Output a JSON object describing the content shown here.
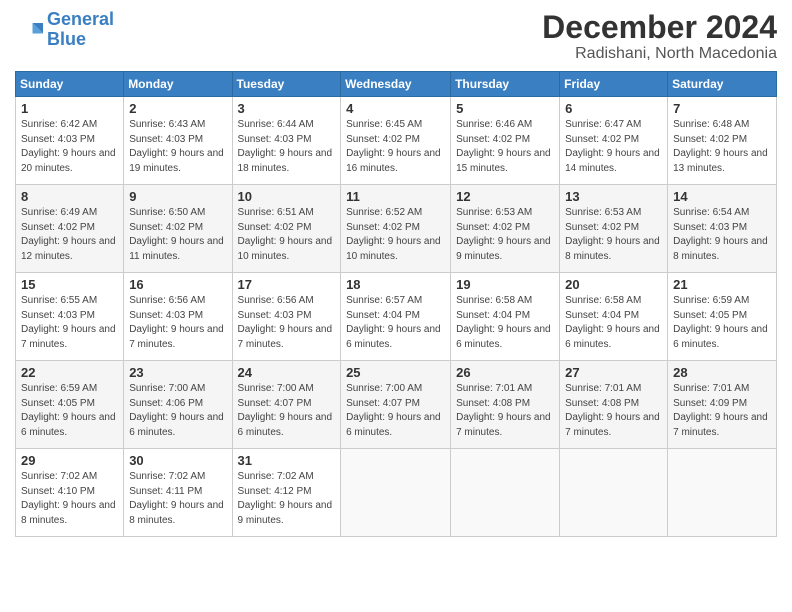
{
  "header": {
    "logo_general": "General",
    "logo_blue": "Blue",
    "month": "December 2024",
    "location": "Radishani, North Macedonia"
  },
  "days_of_week": [
    "Sunday",
    "Monday",
    "Tuesday",
    "Wednesday",
    "Thursday",
    "Friday",
    "Saturday"
  ],
  "weeks": [
    [
      {
        "day": "1",
        "sunrise": "6:42 AM",
        "sunset": "4:03 PM",
        "daylight": "9 hours and 20 minutes."
      },
      {
        "day": "2",
        "sunrise": "6:43 AM",
        "sunset": "4:03 PM",
        "daylight": "9 hours and 19 minutes."
      },
      {
        "day": "3",
        "sunrise": "6:44 AM",
        "sunset": "4:03 PM",
        "daylight": "9 hours and 18 minutes."
      },
      {
        "day": "4",
        "sunrise": "6:45 AM",
        "sunset": "4:02 PM",
        "daylight": "9 hours and 16 minutes."
      },
      {
        "day": "5",
        "sunrise": "6:46 AM",
        "sunset": "4:02 PM",
        "daylight": "9 hours and 15 minutes."
      },
      {
        "day": "6",
        "sunrise": "6:47 AM",
        "sunset": "4:02 PM",
        "daylight": "9 hours and 14 minutes."
      },
      {
        "day": "7",
        "sunrise": "6:48 AM",
        "sunset": "4:02 PM",
        "daylight": "9 hours and 13 minutes."
      }
    ],
    [
      {
        "day": "8",
        "sunrise": "6:49 AM",
        "sunset": "4:02 PM",
        "daylight": "9 hours and 12 minutes."
      },
      {
        "day": "9",
        "sunrise": "6:50 AM",
        "sunset": "4:02 PM",
        "daylight": "9 hours and 11 minutes."
      },
      {
        "day": "10",
        "sunrise": "6:51 AM",
        "sunset": "4:02 PM",
        "daylight": "9 hours and 10 minutes."
      },
      {
        "day": "11",
        "sunrise": "6:52 AM",
        "sunset": "4:02 PM",
        "daylight": "9 hours and 10 minutes."
      },
      {
        "day": "12",
        "sunrise": "6:53 AM",
        "sunset": "4:02 PM",
        "daylight": "9 hours and 9 minutes."
      },
      {
        "day": "13",
        "sunrise": "6:53 AM",
        "sunset": "4:02 PM",
        "daylight": "9 hours and 8 minutes."
      },
      {
        "day": "14",
        "sunrise": "6:54 AM",
        "sunset": "4:03 PM",
        "daylight": "9 hours and 8 minutes."
      }
    ],
    [
      {
        "day": "15",
        "sunrise": "6:55 AM",
        "sunset": "4:03 PM",
        "daylight": "9 hours and 7 minutes."
      },
      {
        "day": "16",
        "sunrise": "6:56 AM",
        "sunset": "4:03 PM",
        "daylight": "9 hours and 7 minutes."
      },
      {
        "day": "17",
        "sunrise": "6:56 AM",
        "sunset": "4:03 PM",
        "daylight": "9 hours and 7 minutes."
      },
      {
        "day": "18",
        "sunrise": "6:57 AM",
        "sunset": "4:04 PM",
        "daylight": "9 hours and 6 minutes."
      },
      {
        "day": "19",
        "sunrise": "6:58 AM",
        "sunset": "4:04 PM",
        "daylight": "9 hours and 6 minutes."
      },
      {
        "day": "20",
        "sunrise": "6:58 AM",
        "sunset": "4:04 PM",
        "daylight": "9 hours and 6 minutes."
      },
      {
        "day": "21",
        "sunrise": "6:59 AM",
        "sunset": "4:05 PM",
        "daylight": "9 hours and 6 minutes."
      }
    ],
    [
      {
        "day": "22",
        "sunrise": "6:59 AM",
        "sunset": "4:05 PM",
        "daylight": "9 hours and 6 minutes."
      },
      {
        "day": "23",
        "sunrise": "7:00 AM",
        "sunset": "4:06 PM",
        "daylight": "9 hours and 6 minutes."
      },
      {
        "day": "24",
        "sunrise": "7:00 AM",
        "sunset": "4:07 PM",
        "daylight": "9 hours and 6 minutes."
      },
      {
        "day": "25",
        "sunrise": "7:00 AM",
        "sunset": "4:07 PM",
        "daylight": "9 hours and 6 minutes."
      },
      {
        "day": "26",
        "sunrise": "7:01 AM",
        "sunset": "4:08 PM",
        "daylight": "9 hours and 7 minutes."
      },
      {
        "day": "27",
        "sunrise": "7:01 AM",
        "sunset": "4:08 PM",
        "daylight": "9 hours and 7 minutes."
      },
      {
        "day": "28",
        "sunrise": "7:01 AM",
        "sunset": "4:09 PM",
        "daylight": "9 hours and 7 minutes."
      }
    ],
    [
      {
        "day": "29",
        "sunrise": "7:02 AM",
        "sunset": "4:10 PM",
        "daylight": "9 hours and 8 minutes."
      },
      {
        "day": "30",
        "sunrise": "7:02 AM",
        "sunset": "4:11 PM",
        "daylight": "9 hours and 8 minutes."
      },
      {
        "day": "31",
        "sunrise": "7:02 AM",
        "sunset": "4:12 PM",
        "daylight": "9 hours and 9 minutes."
      },
      null,
      null,
      null,
      null
    ]
  ],
  "labels": {
    "sunrise": "Sunrise:",
    "sunset": "Sunset:",
    "daylight": "Daylight:"
  }
}
